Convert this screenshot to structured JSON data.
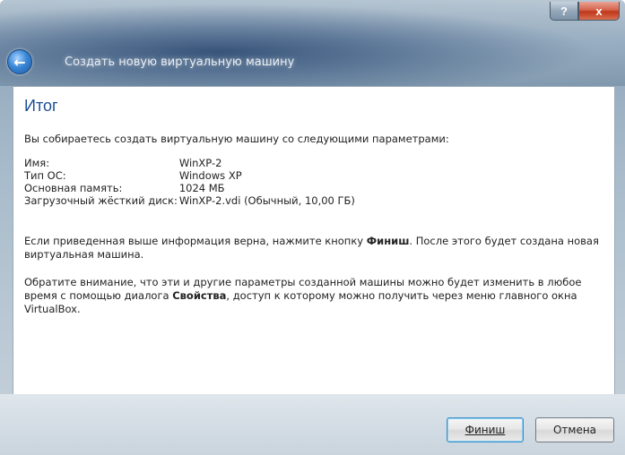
{
  "window": {
    "title": "Создать новую виртуальную машину",
    "help_glyph": "?",
    "close_glyph": "x",
    "back_glyph": "←"
  },
  "page": {
    "title": "Итог",
    "intro": "Вы собираетесь создать виртуальную машину со следующими параметрами:"
  },
  "params": [
    {
      "label": "Имя:",
      "value": "WinXP-2"
    },
    {
      "label": "Тип ОС:",
      "value": "Windows XP"
    },
    {
      "label": "Основная память:",
      "value": "1024 МБ"
    },
    {
      "label": "Загрузочный жёсткий диск:",
      "value": "WinXP-2.vdi (Обычный, 10,00 ГБ)"
    }
  ],
  "paragraph1": {
    "before": "Если приведенная выше информация верна, нажмите кнопку ",
    "bold": "Финиш",
    "after": ". После этого будет создана новая виртуальная машина."
  },
  "paragraph2": {
    "before": "Обратите внимание, что эти и другие параметры созданной машины можно будет изменить в любое время с помощью диалога ",
    "bold": "Свойства",
    "after": ", доступ к которому можно получить через меню главного окна VirtualBox."
  },
  "buttons": {
    "finish": "Финиш",
    "cancel": "Отмена"
  },
  "colors": {
    "title_text": "#1d4f92",
    "accent": "#3b8ec6"
  },
  "icons": {
    "back": "back-arrow-icon",
    "help": "help-icon",
    "close": "close-icon"
  }
}
